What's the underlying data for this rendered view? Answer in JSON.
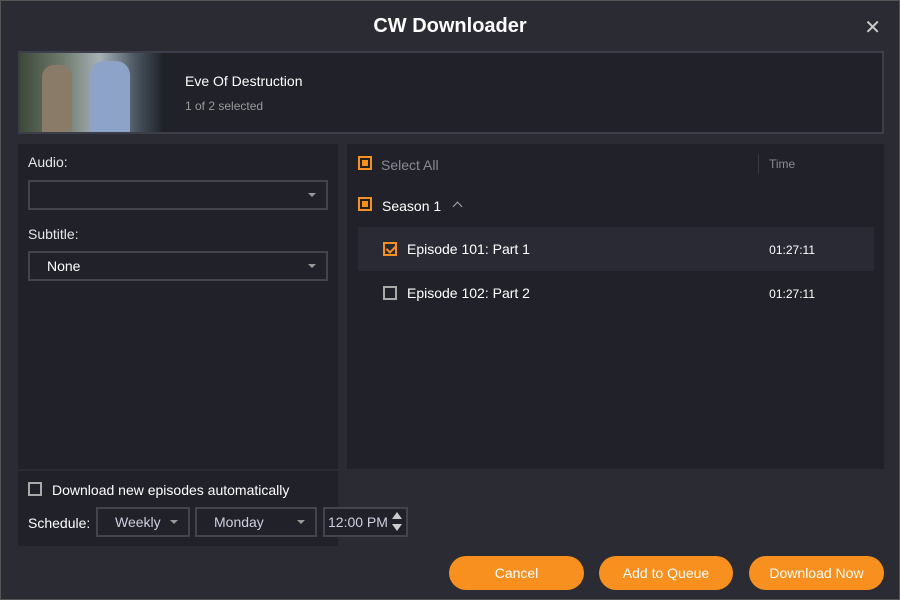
{
  "window": {
    "title": "CW Downloader",
    "close": "✕"
  },
  "show": {
    "title": "Eve Of Destruction",
    "selected": "1 of 2 selected"
  },
  "options": {
    "audio_label": "Audio:",
    "audio_value": "",
    "subtitle_label": "Subtitle:",
    "subtitle_value": "None"
  },
  "list": {
    "select_all": "Select All",
    "time_header": "Time",
    "season": "Season 1",
    "season_icon": "chevron-up",
    "episodes": [
      {
        "title": "Episode 101: Part 1",
        "time": "01:27:11",
        "checked": true
      },
      {
        "title": "Episode 102: Part 2",
        "time": "01:27:11",
        "checked": false
      }
    ]
  },
  "auto": {
    "label": "Download new episodes automatically",
    "schedule_label": "Schedule:",
    "frequency": "Weekly",
    "day": "Monday",
    "time": "12:00 PM"
  },
  "buttons": {
    "cancel": "Cancel",
    "queue": "Add to Queue",
    "download": "Download Now"
  },
  "colors": {
    "accent": "#f7901e"
  }
}
